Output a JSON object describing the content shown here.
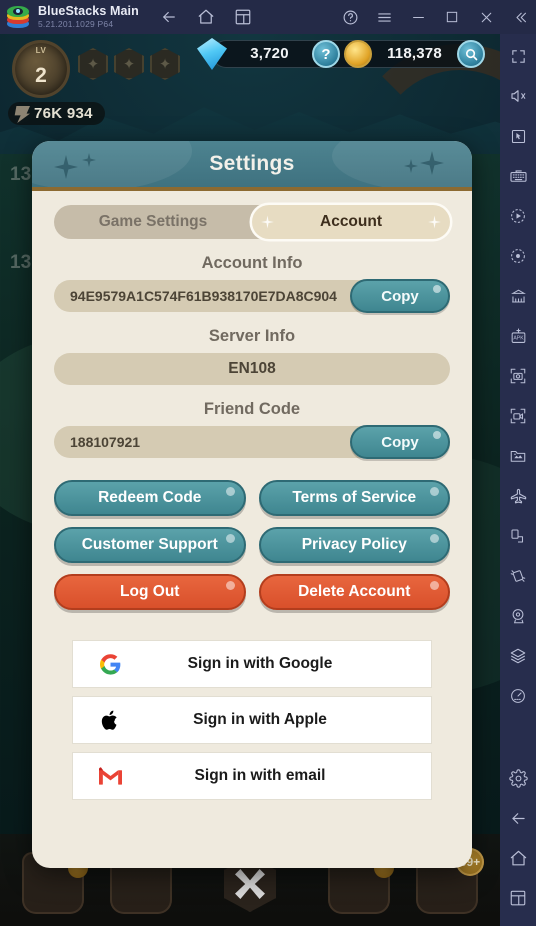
{
  "titlebar": {
    "app_name": "BlueStacks Main",
    "version": "5.21.201.1029  P64",
    "nav_icons": [
      "back-icon",
      "home-icon",
      "multi-instance-icon"
    ],
    "right_icons": [
      "help-icon",
      "menu-icon",
      "minimize-icon",
      "maximize-icon",
      "close-icon",
      "collapse-icon"
    ]
  },
  "game_hud": {
    "level_tag": "LV",
    "level": "2",
    "stat_value": "76K 934",
    "side_numbers": [
      "13",
      "13"
    ],
    "gem_count": "3,720",
    "coin_count": "118,378",
    "help_button": "?",
    "search_button": "search-icon",
    "nav_badge": "99+"
  },
  "modal": {
    "title": "Settings",
    "tabs": [
      {
        "label": "Game Settings",
        "active": false
      },
      {
        "label": "Account",
        "active": true
      }
    ],
    "sections": [
      {
        "label": "Account Info",
        "value": "94E9579A1C574F61B938170E7DA8C904",
        "copy_label": "Copy",
        "has_copy": true
      },
      {
        "label": "Server Info",
        "value": "EN108",
        "has_copy": false
      },
      {
        "label": "Friend Code",
        "value": "188107921",
        "copy_label": "Copy",
        "has_copy": true
      }
    ],
    "action_buttons": [
      {
        "label": "Redeem Code",
        "style": "teal"
      },
      {
        "label": "Terms of Service",
        "style": "teal"
      },
      {
        "label": "Customer Support",
        "style": "teal"
      },
      {
        "label": "Privacy Policy",
        "style": "teal"
      },
      {
        "label": "Log Out",
        "style": "red"
      },
      {
        "label": "Delete Account",
        "style": "red"
      }
    ],
    "signin_options": [
      {
        "label": "Sign in with Google",
        "icon": "google-icon"
      },
      {
        "label": "Sign in with Apple",
        "icon": "apple-icon"
      },
      {
        "label": "Sign in with email",
        "icon": "gmail-icon"
      }
    ]
  },
  "sidebar": {
    "icons": [
      "fullscreen-icon",
      "mute-icon",
      "cursor-icon",
      "keyboard-icon",
      "macro-play-icon",
      "macro-record-icon",
      "multi-instance-manager-icon",
      "install-apk-icon",
      "screenshot-icon",
      "screen-record-icon",
      "media-manager-icon",
      "airplane-mode-icon",
      "rotate-icon",
      "shake-icon",
      "location-icon",
      "layers-icon",
      "performance-icon"
    ],
    "bottom_icons": [
      "gear-icon",
      "back-icon",
      "home-icon",
      "recents-icon"
    ]
  },
  "colors": {
    "modal_bg": "#efeade",
    "header_teal": "#3f7280",
    "button_teal": "#4a909a",
    "button_red": "#de5a32",
    "field_bg": "#d5cbb3",
    "titlebar_bg": "#242a47",
    "sidebar_bg": "#272d4d"
  }
}
